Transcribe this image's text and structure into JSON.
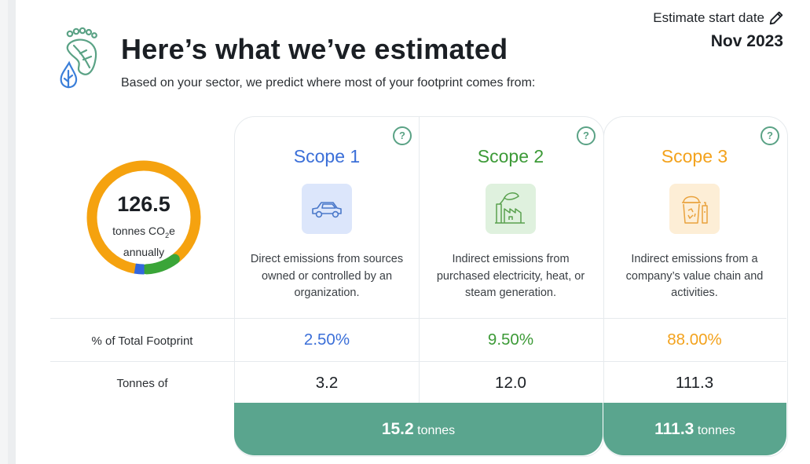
{
  "header": {
    "title": "Here’s what we’ve estimated",
    "subtitle": "Based on your sector, we predict where most of your footprint comes from:",
    "estimate_label": "Estimate start date",
    "estimate_date": "Nov 2023"
  },
  "donut": {
    "value": "126.5",
    "unit_line1": "tonnes CO",
    "unit_sub": "2",
    "unit_line1_suffix": "e",
    "unit_line2": "annually",
    "segments": [
      {
        "name": "Scope 3",
        "fraction": 0.88,
        "color": "#f5a20f"
      },
      {
        "name": "Scope 2",
        "fraction": 0.095,
        "color": "#3aa538"
      },
      {
        "name": "Scope 1",
        "fraction": 0.025,
        "color": "#3367de"
      }
    ]
  },
  "rows": {
    "pct_label": "% of Total Footprint",
    "tonnes_label": "Tonnes of"
  },
  "scopes": [
    {
      "title": "Scope 1",
      "color": "#3b6fd8",
      "icon": "car-icon",
      "icon_bg": "#dce6fb",
      "description_lines": [
        "Direct emissions from sources",
        "owned or controlled by an",
        "organization."
      ],
      "pct": "2.50%",
      "tonnes": "3.2"
    },
    {
      "title": "Scope 2",
      "color": "#3c9a37",
      "icon": "factory-icon",
      "icon_bg": "#dff1de",
      "description_lines": [
        "Indirect emissions from",
        "purchased electricity, heat, or",
        "steam generation."
      ],
      "pct": "9.50%",
      "tonnes": "12.0"
    },
    {
      "title": "Scope 3",
      "color": "#f3a21c",
      "icon": "recycle-bin-icon",
      "icon_bg": "#fdeed6",
      "description_lines": [
        "Indirect emissions from a",
        "company’s value chain and",
        "activities."
      ],
      "pct": "88.00%",
      "tonnes": "111.3"
    }
  ],
  "totals": [
    {
      "value": "15.2",
      "unit": "tonnes"
    },
    {
      "value": "111.3",
      "unit": "tonnes"
    }
  ],
  "help_glyph": "?"
}
